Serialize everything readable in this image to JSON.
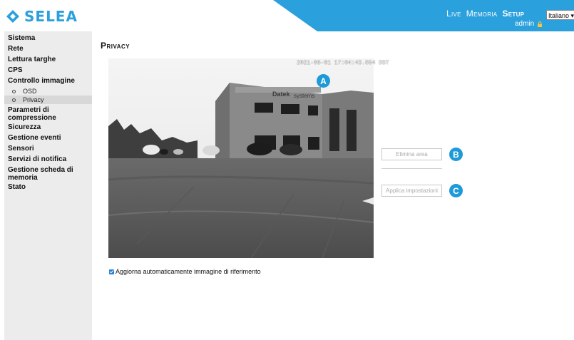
{
  "brand": {
    "name": "SELEA",
    "color": "#2aa0dc"
  },
  "header": {
    "nav": [
      {
        "label": "Live",
        "active": false
      },
      {
        "label": "Memoria",
        "active": false
      },
      {
        "label": "Setup",
        "active": true
      }
    ],
    "language": "Italiano",
    "user": "admin",
    "bar_color": "#2aa0dc"
  },
  "sidebar": {
    "items": [
      {
        "label": "Sistema"
      },
      {
        "label": "Rete"
      },
      {
        "label": "Lettura targhe"
      },
      {
        "label": "CPS"
      },
      {
        "label": "Controllo immagine"
      },
      {
        "label": "OSD"
      },
      {
        "label": "Privacy"
      },
      {
        "label": "Parametri di compressione"
      },
      {
        "label": "Sicurezza"
      },
      {
        "label": "Gestione eventi"
      },
      {
        "label": "Sensori"
      },
      {
        "label": "Servizi di notifica"
      },
      {
        "label": "Gestione scheda di memoria"
      },
      {
        "label": "Stato"
      }
    ]
  },
  "main": {
    "title": "Privacy",
    "camera": {
      "timestamp": "2021-06-01 17:04:43.654 DST",
      "building_sign": "Datek",
      "building_sign_2": "systems"
    },
    "buttons": {
      "delete_area": "Elimina area",
      "apply_settings": "Applica impostazioni"
    },
    "markers": [
      "A",
      "B",
      "C"
    ],
    "checkbox": {
      "label": "Aggiorna automaticamente immagine di riferimento",
      "checked": true
    }
  }
}
